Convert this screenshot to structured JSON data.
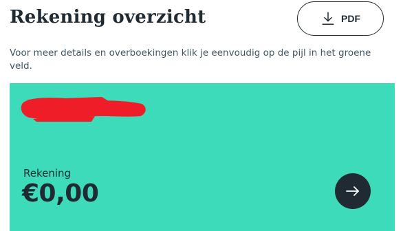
{
  "header": {
    "title": "Rekening overzicht",
    "pdf_button": {
      "label": "PDF",
      "icon": "download-icon"
    }
  },
  "intro_text": "Voor meer details en overboekingen klik je eenvoudig op de pijl in het groene veld.",
  "account_card": {
    "background_color": "#3ddbb9",
    "account_name_redacted": true,
    "redaction_color": "#ef1d27",
    "label": "Rekening",
    "balance": "€0,00",
    "arrow_button": {
      "icon": "arrow-right-icon"
    }
  }
}
